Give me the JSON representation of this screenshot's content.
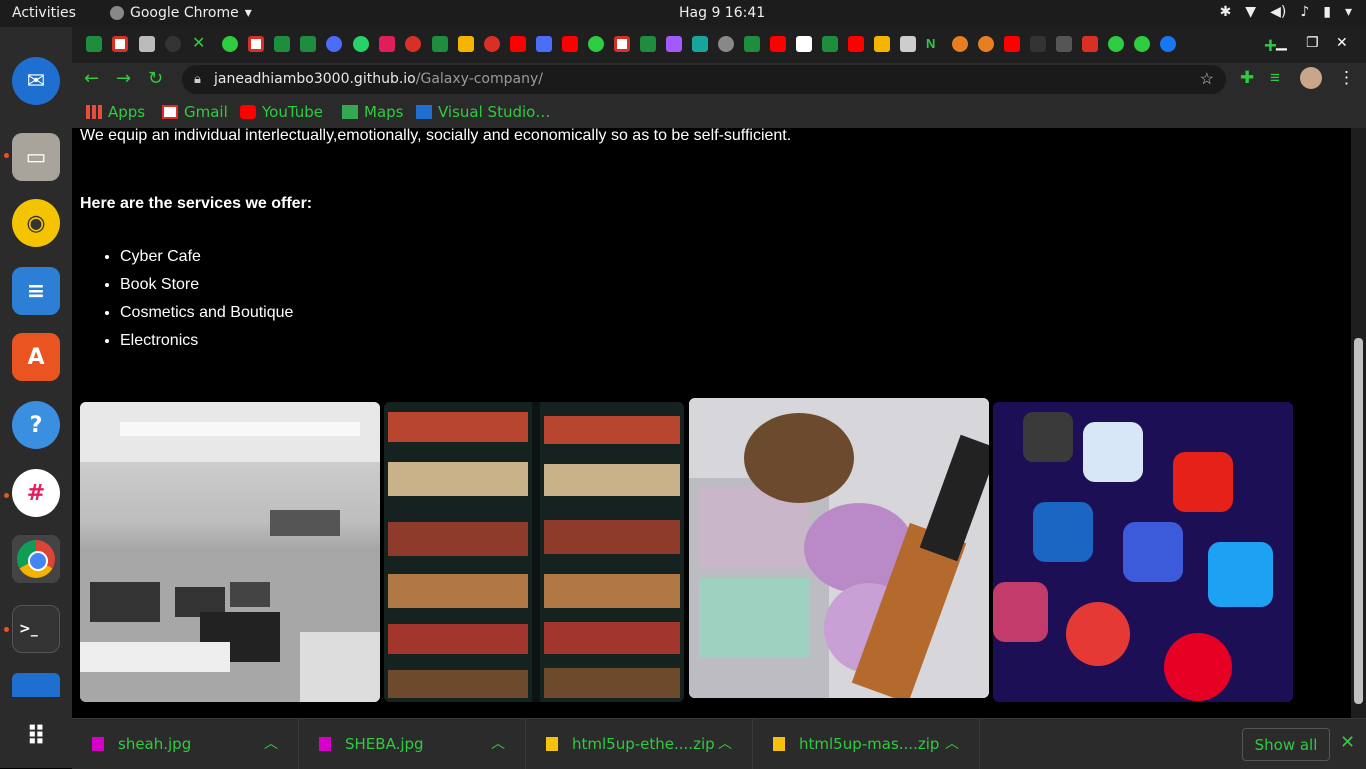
{
  "system": {
    "activities": "Activities",
    "app_name": "Google Chrome",
    "clock": "Hag 9  16:41"
  },
  "browser": {
    "url_host": "janeadhiambo3000.github.io",
    "url_path": "/Galaxy-company/",
    "bookmarks": [
      "Apps",
      "Gmail",
      "YouTube",
      "Maps",
      "Visual Studio…"
    ]
  },
  "content": {
    "intro": "We equip an individual interlectually,emotionally, socially and economically so as to be self-sufficient.",
    "services_heading": "Here are the services we offer:",
    "services": [
      "Cyber Cafe",
      "Book Store",
      "Cosmetics and Boutique",
      "Electronics"
    ]
  },
  "downloads": {
    "items": [
      "sheah.jpg",
      "SHEBA.jpg",
      "html5up-ethe....zip",
      "html5up-mas....zip"
    ],
    "show_all": "Show all"
  },
  "colors": {
    "accent": "#2ecc40",
    "page_bg": "#000000",
    "chrome_bg": "#2a2a2a"
  }
}
